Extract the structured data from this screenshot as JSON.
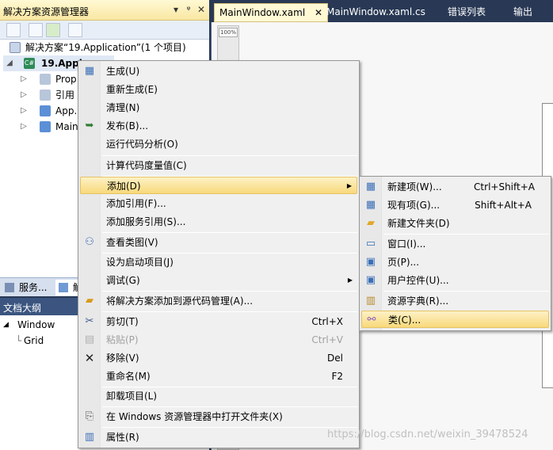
{
  "solution_explorer": {
    "title": "解决方案资源管理器",
    "pin": "ᵠ",
    "close": "✕",
    "solution_label": "解决方案“19.Application”(1 个项目)",
    "project_label": "19.Appl",
    "items": [
      {
        "label": "Prop"
      },
      {
        "label": "引用"
      },
      {
        "label": "App."
      },
      {
        "label": "Main"
      }
    ]
  },
  "bottom_tabs": {
    "server_tab": "服务...",
    "solution_tab": "解"
  },
  "document_outline": {
    "title": "文档大纲",
    "root": "Window",
    "child": "Grid"
  },
  "editor_tabs": [
    {
      "label": "MainWindow.xaml",
      "active": true,
      "close": "✕"
    },
    {
      "label": "MainWindow.xaml.cs"
    },
    {
      "label": "错误列表"
    },
    {
      "label": "输出"
    }
  ],
  "zoom_level": "100%",
  "context_menu": {
    "items": [
      {
        "label": "生成(U)",
        "icon": "build-icon"
      },
      {
        "label": "重新生成(E)"
      },
      {
        "label": "清理(N)"
      },
      {
        "label": "发布(B)...",
        "icon": "publish-icon"
      },
      {
        "label": "运行代码分析(O)"
      },
      {
        "label": "计算代码度量值(C)"
      },
      {
        "label": "添加(D)",
        "submenu": "▶"
      },
      {
        "label": "添加引用(F)..."
      },
      {
        "label": "添加服务引用(S)..."
      },
      {
        "label": "查看类图(V)",
        "icon": "class-diagram-icon"
      },
      {
        "label": "设为启动项目(J)"
      },
      {
        "label": "调试(G)",
        "submenu": "▶"
      },
      {
        "label": "将解决方案添加到源代码管理(A)...",
        "icon": "source-control-icon"
      },
      {
        "label": "剪切(T)",
        "shortcut": "Ctrl+X",
        "icon": "cut-icon"
      },
      {
        "label": "粘贴(P)",
        "shortcut": "Ctrl+V",
        "disabled": true,
        "icon": "paste-icon"
      },
      {
        "label": "移除(V)",
        "shortcut": "Del",
        "icon": "remove-icon"
      },
      {
        "label": "重命名(M)",
        "shortcut": "F2"
      },
      {
        "label": "卸载项目(L)"
      },
      {
        "label": "在 Windows 资源管理器中打开文件夹(X)",
        "icon": "open-folder-icon"
      },
      {
        "label": "属性(R)",
        "icon": "properties-icon"
      }
    ]
  },
  "add_submenu": {
    "items": [
      {
        "label": "新建项(W)...",
        "shortcut": "Ctrl+Shift+A",
        "icon": "new-item-icon"
      },
      {
        "label": "现有项(G)...",
        "shortcut": "Shift+Alt+A",
        "icon": "existing-item-icon"
      },
      {
        "label": "新建文件夹(D)",
        "icon": "new-folder-icon"
      },
      {
        "label": "窗口(I)...",
        "icon": "window-icon"
      },
      {
        "label": "页(P)...",
        "icon": "page-icon"
      },
      {
        "label": "用户控件(U)...",
        "icon": "user-control-icon"
      },
      {
        "label": "资源字典(R)...",
        "icon": "resource-dictionary-icon"
      },
      {
        "label": "类(C)...",
        "icon": "class-icon"
      }
    ]
  },
  "watermark": "https://blog.csdn.net/weixin_39478524",
  "colors": {
    "chrome": "#293955",
    "highlight": "#f8d97b",
    "menu_bg": "#f0f0f0"
  }
}
